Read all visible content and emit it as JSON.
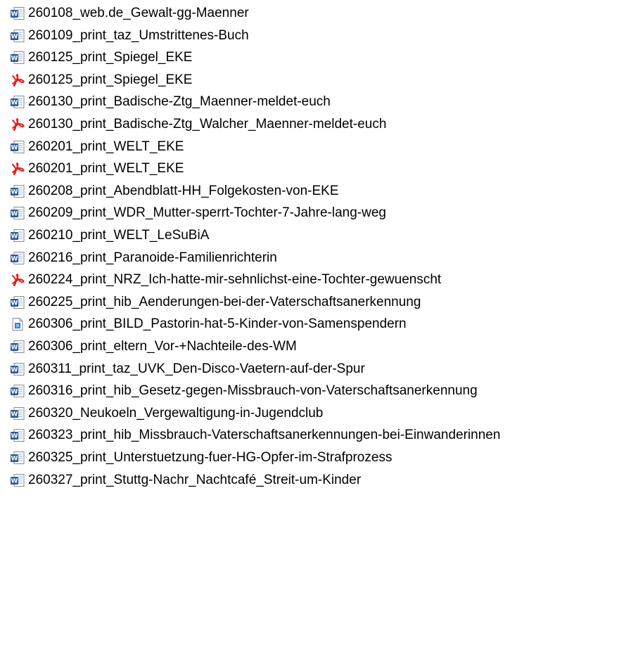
{
  "file_list": {
    "items": [
      {
        "name": "260108_web.de_Gewalt-gg-Maenner",
        "icon": "word-document-icon"
      },
      {
        "name": "260109_print_taz_Umstrittenes-Buch",
        "icon": "word-document-icon"
      },
      {
        "name": "260125_print_Spiegel_EKE",
        "icon": "word-document-icon"
      },
      {
        "name": "260125_print_Spiegel_EKE",
        "icon": "pdf-document-icon"
      },
      {
        "name": "260130_print_Badische-Ztg_Maenner-meldet-euch",
        "icon": "word-document-icon"
      },
      {
        "name": "260130_print_Badische-Ztg_Walcher_Maenner-meldet-euch",
        "icon": "pdf-document-icon"
      },
      {
        "name": "260201_print_WELT_EKE",
        "icon": "word-document-icon"
      },
      {
        "name": "260201_print_WELT_EKE",
        "icon": "pdf-document-icon"
      },
      {
        "name": "260208_print_Abendblatt-HH_Folgekosten-von-EKE",
        "icon": "word-document-icon"
      },
      {
        "name": "260209_print_WDR_Mutter-sperrt-Tochter-7-Jahre-lang-weg",
        "icon": "word-document-icon"
      },
      {
        "name": "260210_print_WELT_LeSuBiA",
        "icon": "word-document-icon"
      },
      {
        "name": "260216_print_Paranoide-Familienrichterin",
        "icon": "word-document-icon"
      },
      {
        "name": "260224_print_NRZ_Ich-hatte-mir-sehnlichst-eine-Tochter-gewuenscht",
        "icon": "pdf-document-icon"
      },
      {
        "name": "260225_print_hib_Aenderungen-bei-der-Vaterschaftsanerkennung",
        "icon": "word-document-icon"
      },
      {
        "name": "260306_print_BILD_Pastorin-hat-5-Kinder-von-Samenspendern",
        "icon": "image-file-icon"
      },
      {
        "name": "260306_print_eltern_Vor-+Nachteile-des-WM",
        "icon": "word-document-icon"
      },
      {
        "name": "260311_print_taz_UVK_Den-Disco-Vaetern-auf-der-Spur",
        "icon": "word-document-icon"
      },
      {
        "name": "260316_print_hib_Gesetz-gegen-Missbrauch-von-Vaterschaftsanerkennung",
        "icon": "word-document-icon"
      },
      {
        "name": "260320_Neukoeln_Vergewaltigung-in-Jugendclub",
        "icon": "word-document-icon"
      },
      {
        "name": "260323_print_hib_Missbrauch-Vaterschaftsanerkennungen-bei-Einwanderinnen",
        "icon": "word-document-icon"
      },
      {
        "name": "260325_print_Unterstuetzung-fuer-HG-Opfer-im-Strafprozess",
        "icon": "word-document-icon"
      },
      {
        "name": "260327_print_Stuttg-Nachr_Nachtcafé_Streit-um-Kinder",
        "icon": "word-document-icon"
      }
    ]
  },
  "colors": {
    "word_blue": "#2b579a",
    "pdf_red": "#e02020",
    "image_blue": "#1e73d6",
    "paper": "#ffffff",
    "paper_border": "#8a8a8a"
  }
}
